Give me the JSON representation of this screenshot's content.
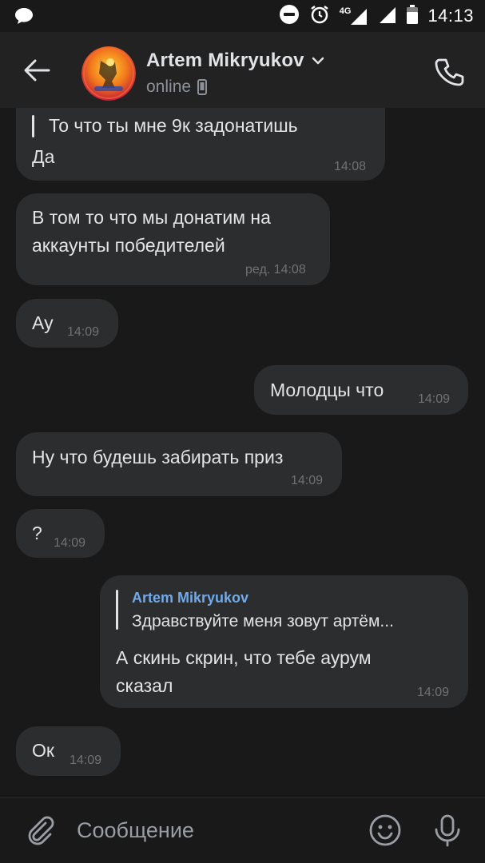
{
  "status_bar": {
    "time": "14:13",
    "network": "4G",
    "icons": [
      "chat-bubble-icon",
      "dnd-icon",
      "alarm-icon",
      "signal-icon",
      "battery-icon"
    ]
  },
  "header": {
    "back_icon": "arrow-left-icon",
    "contact_name": "Artem Mikryukov",
    "contact_status": "online",
    "call_icon": "phone-icon"
  },
  "messages": [
    {
      "side": "in",
      "reply_text": "То что ты мне 9к задонатишь",
      "text": "Да",
      "time": "14:08"
    },
    {
      "side": "in",
      "lines": [
        "В том то что мы донатим на",
        "аккаунты победителей"
      ],
      "time": "ред. 14:08"
    },
    {
      "side": "in",
      "text": "Ау",
      "time": "14:09"
    },
    {
      "side": "out",
      "text": "Молодцы что",
      "time": "14:09"
    },
    {
      "side": "in",
      "text": "Ну что будешь забирать приз",
      "time": "14:09"
    },
    {
      "side": "in",
      "text": "?",
      "time": "14:09"
    },
    {
      "side": "out",
      "reply_author": "Artem Mikryukov",
      "reply_text": "Здравствуйте меня зовут артём...",
      "lines": [
        "А скинь скрин, что  тебе аурум",
        "сказал"
      ],
      "time": "14:09"
    },
    {
      "side": "in",
      "text": "Ок",
      "time": "14:09"
    }
  ],
  "composer": {
    "placeholder": "Сообщение",
    "value": "",
    "icons": [
      "paperclip-icon",
      "emoji-icon",
      "microphone-icon"
    ]
  },
  "colors": {
    "background": "#19191a",
    "header": "#222222",
    "bubble": "#2c2d2e",
    "text": "#e1e3e6",
    "time": "#6e7175",
    "accent": "#71aaeb"
  }
}
